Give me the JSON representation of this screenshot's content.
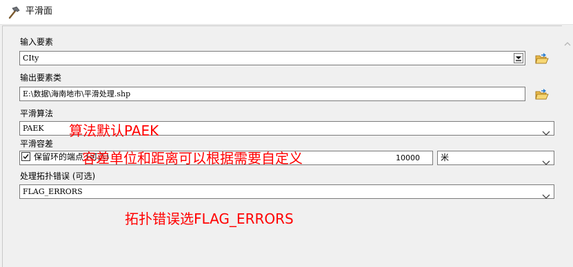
{
  "window": {
    "title": "平滑面",
    "icon": "hammer-icon"
  },
  "form": {
    "input_features": {
      "label": "输入要素",
      "value": "CIty",
      "folder_icon": "open-folder-icon"
    },
    "output_feature_class": {
      "label": "输出要素类",
      "value": "E:\\数据\\海南地市\\平滑处理.shp",
      "folder_icon": "open-folder-icon"
    },
    "smoothing_algorithm": {
      "label": "平滑算法",
      "value": "PAEK"
    },
    "smoothing_tolerance": {
      "label": "平滑容差",
      "value": "10000",
      "unit": "米"
    },
    "preserve_endpoints": {
      "label": "保留环的端点 (可选)",
      "checked": true
    },
    "topology_errors": {
      "label": "处理拓扑错误 (可选)",
      "value": "FLAG_ERRORS"
    }
  },
  "annotations": {
    "algorithm_note": "算法默认PAEK",
    "tolerance_note": "容差单位和距离可以根据需要自定义",
    "topology_note": "拓扑错误选FLAG_ERRORS"
  },
  "colors": {
    "annotation": "#ff0000",
    "dialog_bg": "#f0f0f0",
    "field_border": "#7a7a7a"
  }
}
